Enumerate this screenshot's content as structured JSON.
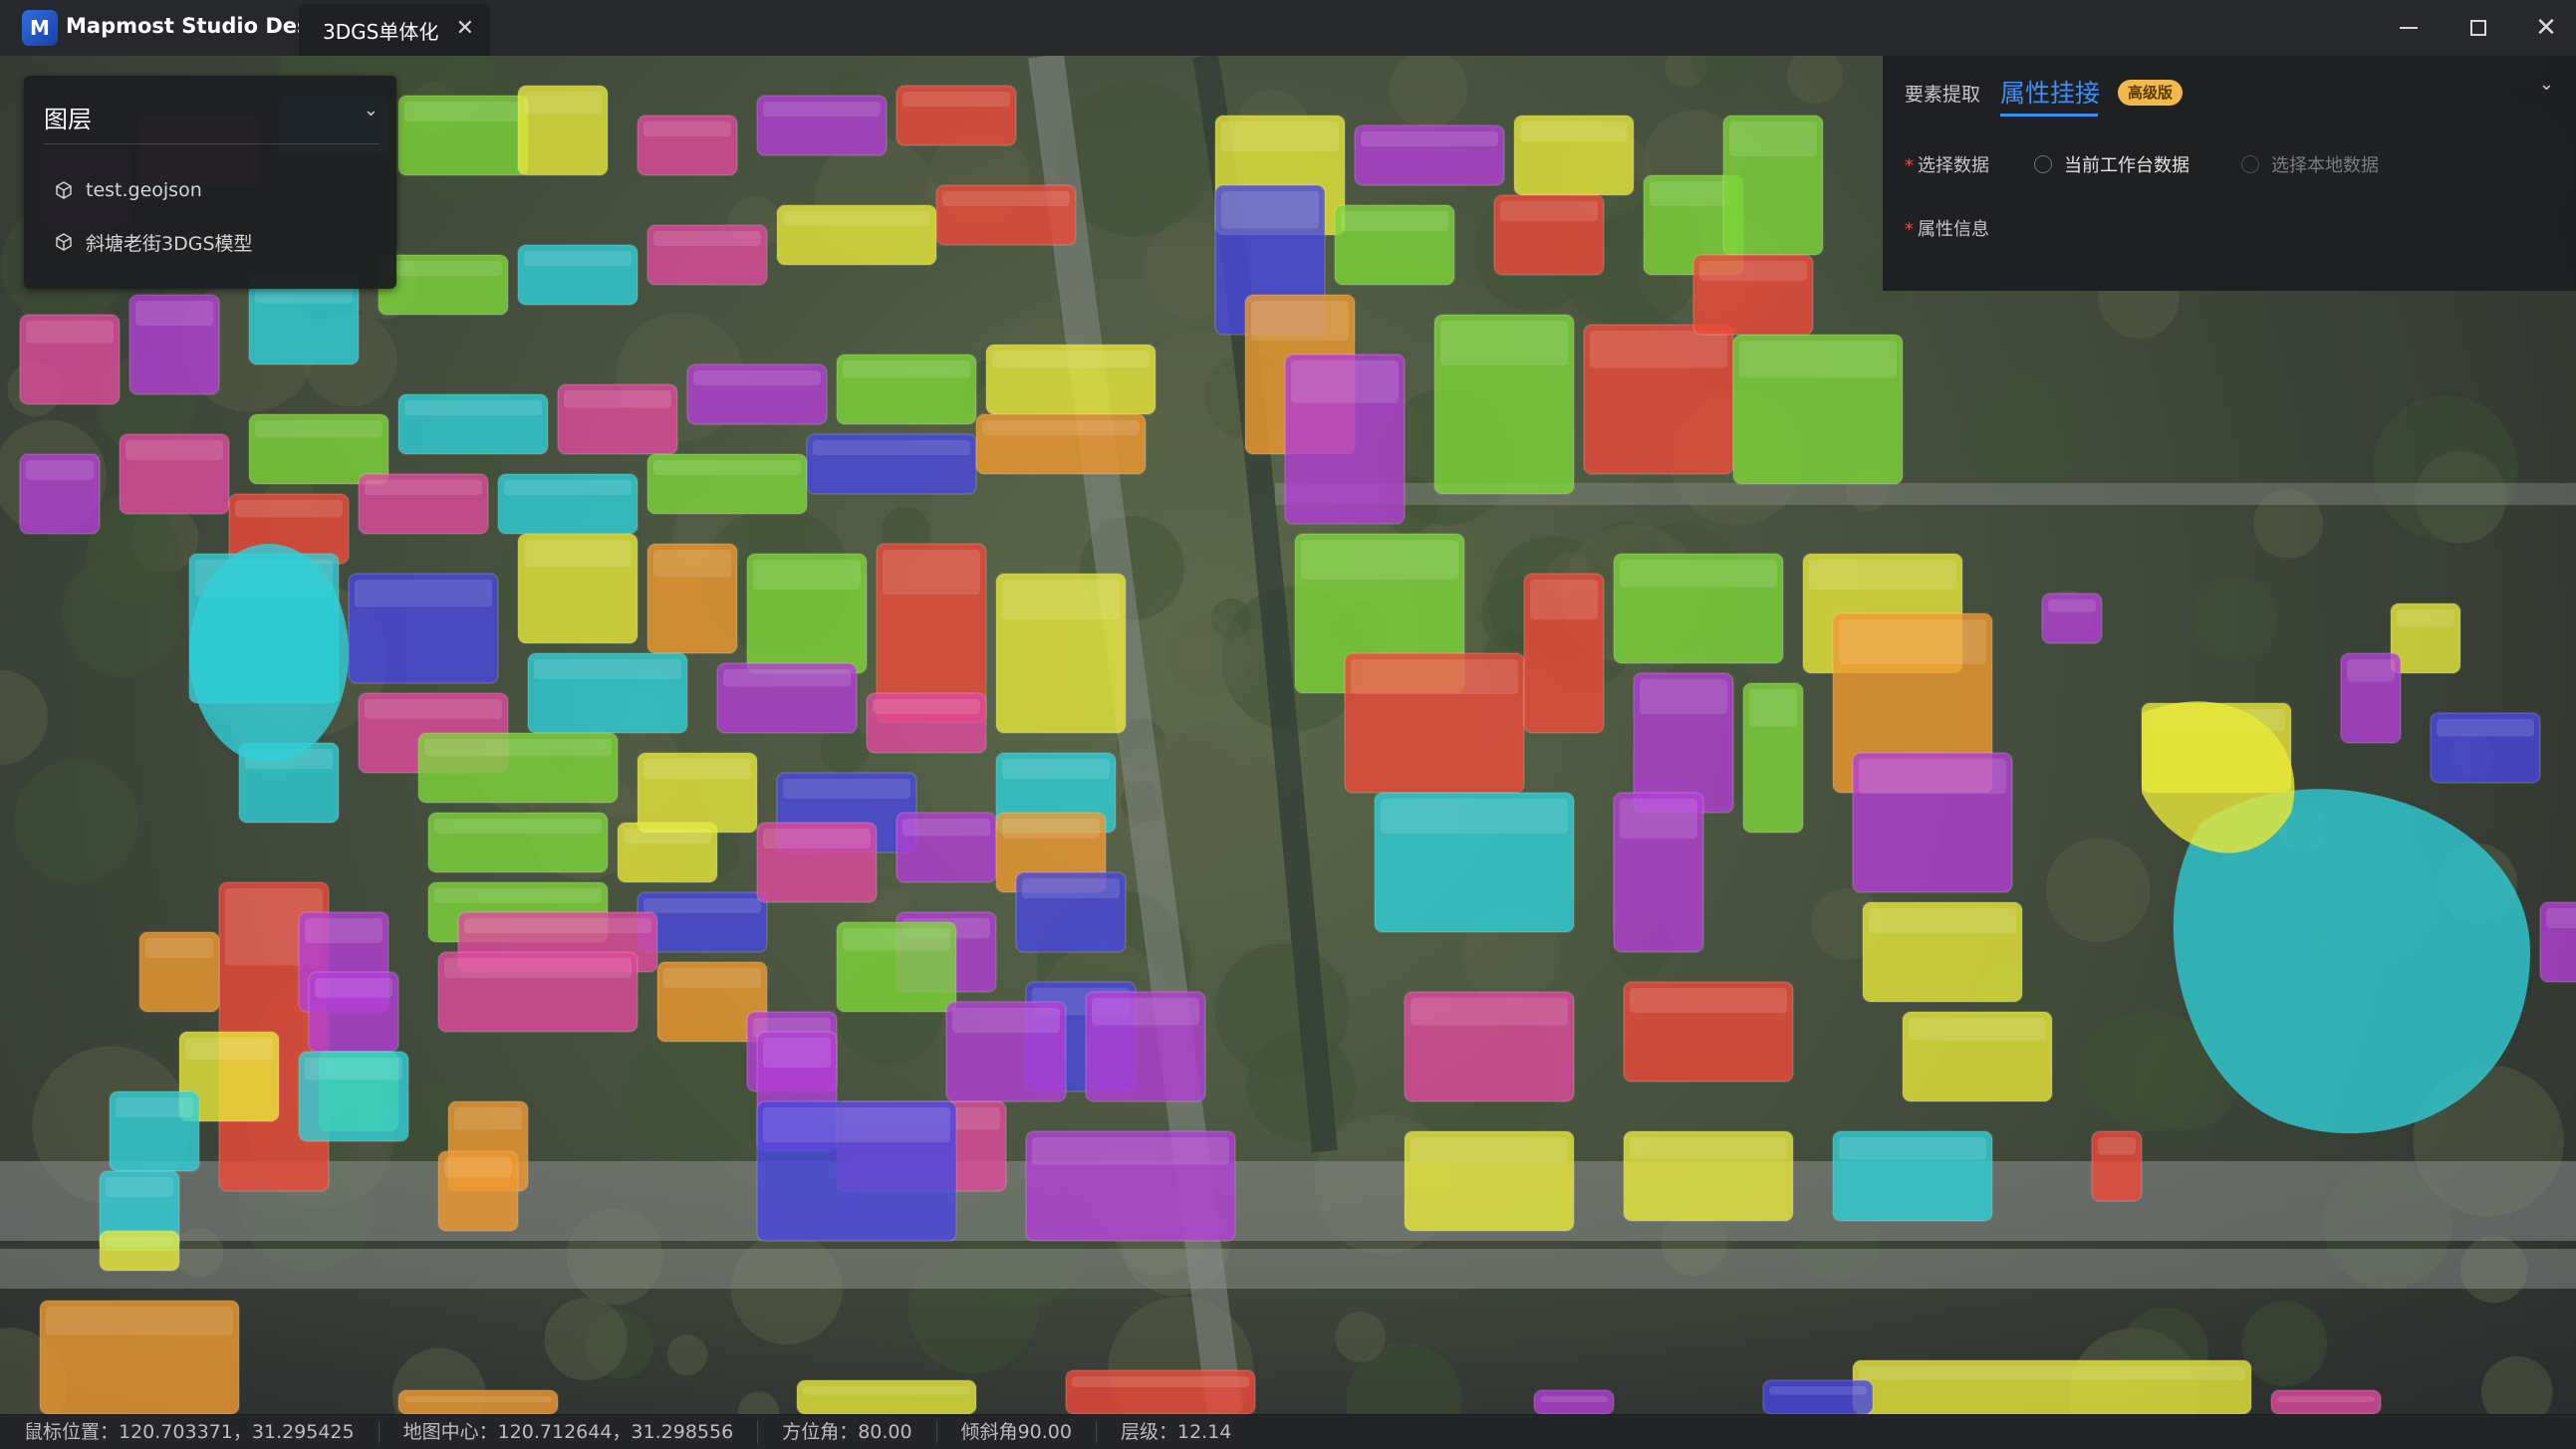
{
  "window": {
    "app_title": "Mapmost Studio Desktop",
    "logo_letter": "M",
    "tab_label": "3DGS单体化",
    "tab_close": "✕",
    "close_glyph": "✕"
  },
  "layer_panel": {
    "title": "图层",
    "chevron": "⌄",
    "items": [
      {
        "label": "test.geojson"
      },
      {
        "label": "斜塘老街3DGS模型"
      }
    ]
  },
  "attr_panel": {
    "tab_extract": "要素提取",
    "tab_join": "属性挂接",
    "badge": "高级版",
    "chevron": "⌄",
    "select_data_label": "选择数据",
    "radio_current": "当前工作台数据",
    "radio_local": "选择本地数据",
    "attr_info_label": "属性信息",
    "required_mark": "*"
  },
  "status": {
    "mouse": "鼠标位置：120.703371，31.295425",
    "center": "地图中心：120.712644，31.298556",
    "azimuth": "方位角：80.00",
    "tilt": "倾斜角90.00",
    "zoom": "层级：12.14"
  },
  "colors": {
    "accent": "#3d8ff5",
    "badge": "#f2b84b",
    "building_palette": [
      "#b33fd6",
      "#e04a9e",
      "#2fd0d8",
      "#7ed63a",
      "#e8e83a",
      "#ef4a3a",
      "#4848e0",
      "#f09a30",
      "#40e03a"
    ]
  }
}
